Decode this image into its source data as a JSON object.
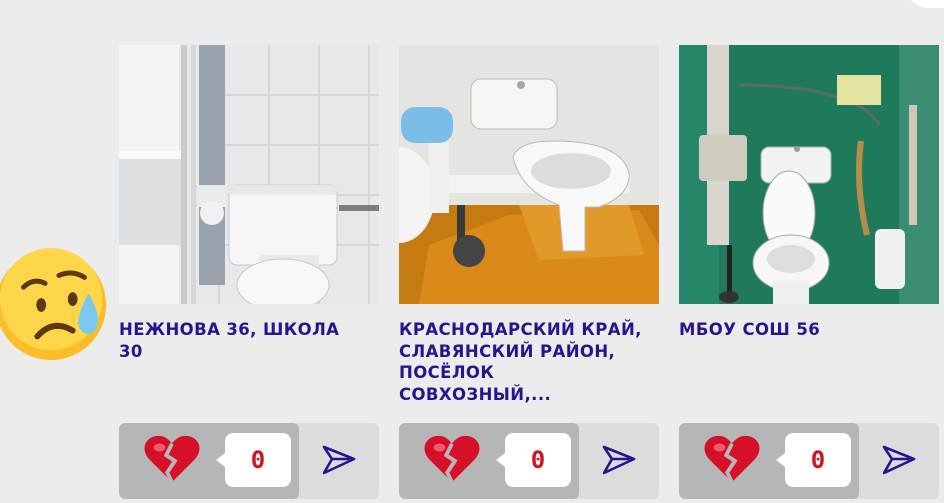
{
  "cards": [
    {
      "title": "НЕЖНОВА 36, ШКОЛА 30",
      "count": "0",
      "reaction_icon": "broken-heart-icon",
      "share_icon": "send-icon"
    },
    {
      "title": "КРАСНОДАРСКИЙ КРАЙ, СЛАВЯНСКИЙ РАЙОН, ПОСЁЛОК СОВХОЗНЫЙ,...",
      "count": "0",
      "reaction_icon": "broken-heart-icon",
      "share_icon": "send-icon"
    },
    {
      "title": "МБОУ СОШ 56",
      "count": "0",
      "reaction_icon": "broken-heart-icon",
      "share_icon": "send-icon"
    }
  ],
  "decor": {
    "emoji": "sad-sweat-face-icon"
  },
  "colors": {
    "title": "#26158e",
    "count": "#d01521",
    "heart": "#d7102a",
    "share_icon": "#26158e",
    "background": "#ececed"
  }
}
